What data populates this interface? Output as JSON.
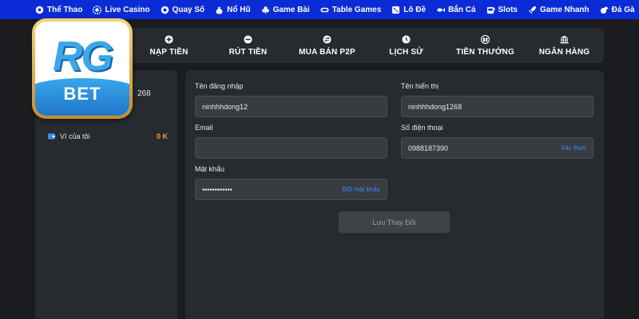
{
  "topnav": {
    "items": [
      {
        "label": "Thể Thao",
        "icon": "soccer-icon"
      },
      {
        "label": "Live Casino",
        "icon": "chip-icon"
      },
      {
        "label": "Quay Số",
        "icon": "lottery-ball-icon"
      },
      {
        "label": "Nổ Hũ",
        "icon": "money-bag-icon"
      },
      {
        "label": "Game Bài",
        "icon": "club-card-icon"
      },
      {
        "label": "Table Games",
        "icon": "table-icon"
      },
      {
        "label": "Lô Đề",
        "icon": "dice-icon"
      },
      {
        "label": "Bắn Cá",
        "icon": "fish-icon"
      },
      {
        "label": "Slots",
        "icon": "slot-machine-icon"
      },
      {
        "label": "Game Nhanh",
        "icon": "rocket-icon"
      },
      {
        "label": "Đá Gà",
        "icon": "rooster-icon"
      }
    ]
  },
  "tabs": [
    {
      "label": "NẠP TIỀN",
      "icon": "plus-circle-icon"
    },
    {
      "label": "RÚT TIỀN",
      "icon": "minus-circle-icon"
    },
    {
      "label": "MUA BÁN P2P",
      "icon": "swap-icon"
    },
    {
      "label": "LỊCH SỬ",
      "icon": "clock-icon"
    },
    {
      "label": "TIỀN THƯỞNG",
      "icon": "gift-icon"
    },
    {
      "label": "NGÂN HÀNG",
      "icon": "bank-icon"
    }
  ],
  "sidebar": {
    "username_fragment": "268",
    "wallet_label": "Ví của tôi",
    "wallet_amount": "0 K"
  },
  "logo": {
    "top_text": "RG",
    "bottom_text": "BET"
  },
  "form": {
    "username": {
      "label": "Tên đăng nhập",
      "value": "ninhhhdong12"
    },
    "display_name": {
      "label": "Tên hiển thị",
      "value": "ninhhhdong1268"
    },
    "email": {
      "label": "Email",
      "value": ""
    },
    "phone": {
      "label": "Số điện thoại",
      "value": "0988187390",
      "action": "Xác thực"
    },
    "password": {
      "label": "Mật khẩu",
      "value": "••••••••••••",
      "action": "Đổi mật khẩu"
    },
    "save_label": "Lưu Thay Đổi"
  },
  "colors": {
    "nav_bg": "#0b2bd6",
    "page_bg": "#1a1c1f",
    "panel_bg": "#272a2e",
    "input_bg": "#383b40",
    "link": "#3d8bff",
    "amount": "#f2a23a"
  }
}
